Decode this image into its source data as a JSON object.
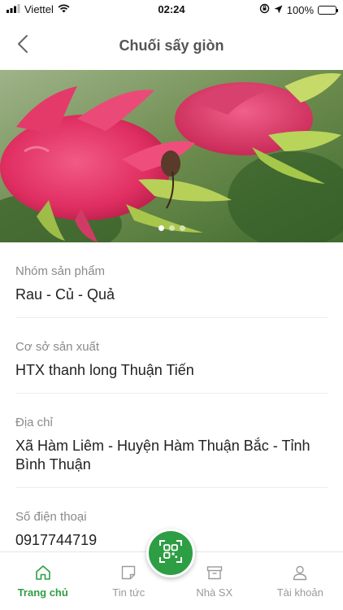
{
  "status_bar": {
    "carrier": "Viettel",
    "time": "02:24",
    "battery": "100%",
    "battery_level": 1.0,
    "icons": [
      "signal-bars-icon",
      "wifi-icon",
      "orientation-lock-icon",
      "location-arrow-icon",
      "battery-charging-icon"
    ]
  },
  "header": {
    "title": "Chuối sấy giòn",
    "back_icon": "chevron-left-icon"
  },
  "carousel": {
    "slide_count": 3,
    "active_index": 0
  },
  "fields": [
    {
      "label": "Nhóm sản phẩm",
      "value": "Rau - Củ - Quả"
    },
    {
      "label": "Cơ sở sản xuất",
      "value": "HTX thanh long Thuận Tiến"
    },
    {
      "label": "Địa chỉ",
      "value": "Xã Hàm Liêm - Huyện Hàm Thuận Bắc - Tỉnh Bình Thuận"
    },
    {
      "label": "Số điện thoại",
      "value": "0917744719"
    }
  ],
  "tabbar": {
    "tabs": [
      {
        "label": "Trang chủ",
        "icon": "home-icon",
        "active": true
      },
      {
        "label": "Tin tức",
        "icon": "news-icon",
        "active": false
      },
      {
        "label": "Nhà SX",
        "icon": "box-icon",
        "active": false
      },
      {
        "label": "Tài khoản",
        "icon": "user-icon",
        "active": false
      }
    ],
    "scan_icon": "qr-scan-icon"
  },
  "colors": {
    "accent": "#2e9e44",
    "inactive": "#9a9a9a",
    "label": "#8a8a8a"
  }
}
